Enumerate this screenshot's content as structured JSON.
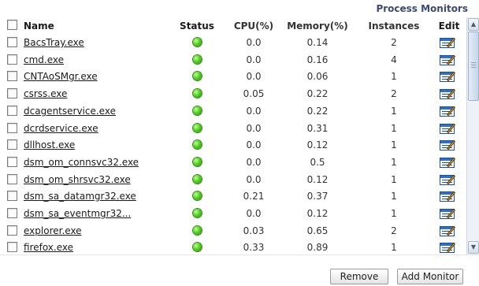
{
  "panel": {
    "title": "Process Monitors"
  },
  "columns": {
    "name": "Name",
    "status": "Status",
    "cpu": "CPU(%)",
    "memory": "Memory(%)",
    "instances": "Instances",
    "edit": "Edit"
  },
  "status_color": "#4fd120",
  "processes": [
    {
      "name": "BacsTray.exe",
      "cpu": "0.0",
      "memory": "0.14",
      "instances": "2"
    },
    {
      "name": "cmd.exe",
      "cpu": "0.0",
      "memory": "0.16",
      "instances": "4"
    },
    {
      "name": "CNTAoSMgr.exe",
      "cpu": "0.0",
      "memory": "0.06",
      "instances": "1"
    },
    {
      "name": "csrss.exe",
      "cpu": "0.05",
      "memory": "0.22",
      "instances": "2"
    },
    {
      "name": "dcagentservice.exe",
      "cpu": "0.0",
      "memory": "0.22",
      "instances": "1"
    },
    {
      "name": "dcrdservice.exe",
      "cpu": "0.0",
      "memory": "0.31",
      "instances": "1"
    },
    {
      "name": "dllhost.exe",
      "cpu": "0.0",
      "memory": "0.12",
      "instances": "1"
    },
    {
      "name": "dsm_om_connsvc32.exe",
      "cpu": "0.0",
      "memory": "0.5",
      "instances": "1"
    },
    {
      "name": "dsm_om_shrsvc32.exe",
      "cpu": "0.0",
      "memory": "0.12",
      "instances": "1"
    },
    {
      "name": "dsm_sa_datamgr32.exe",
      "cpu": "0.21",
      "memory": "0.37",
      "instances": "1"
    },
    {
      "name": "dsm_sa_eventmgr32...",
      "cpu": "0.0",
      "memory": "0.12",
      "instances": "1"
    },
    {
      "name": "explorer.exe",
      "cpu": "0.03",
      "memory": "0.65",
      "instances": "2"
    },
    {
      "name": "firefox.exe",
      "cpu": "0.33",
      "memory": "0.89",
      "instances": "1"
    }
  ],
  "icons": {
    "status": "status-ok-icon",
    "edit": "edit-icon"
  },
  "footer": {
    "remove_label": "Remove",
    "add_label": "Add Monitor"
  }
}
